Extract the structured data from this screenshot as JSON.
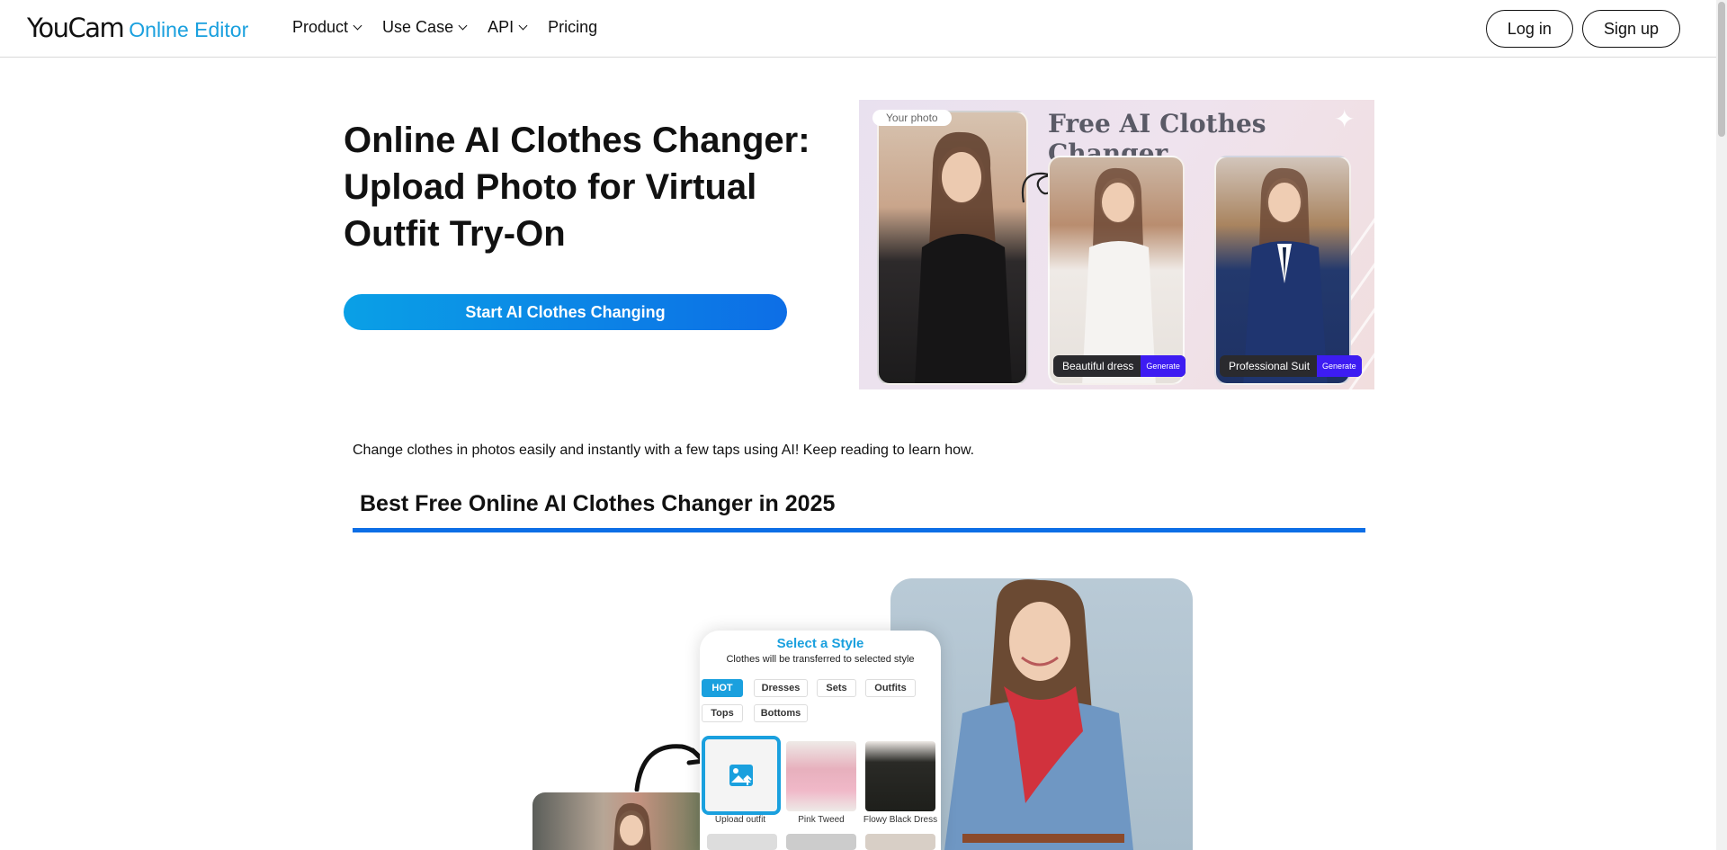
{
  "header": {
    "logo_main": "YouCam",
    "logo_sub": "Online Editor",
    "nav": [
      {
        "label": "Product",
        "has_dropdown": true
      },
      {
        "label": "Use Case",
        "has_dropdown": true
      },
      {
        "label": "API",
        "has_dropdown": true
      },
      {
        "label": "Pricing",
        "has_dropdown": false
      }
    ],
    "login_label": "Log in",
    "signup_label": "Sign up"
  },
  "hero": {
    "title": "Online AI Clothes Changer: Upload Photo for Virtual Outfit Try-On",
    "cta_label": "Start AI Clothes Changing",
    "banner": {
      "title": "Free AI Clothes Changer",
      "photo_tag": "Your photo",
      "results": [
        {
          "label": "Beautiful dress",
          "button": "Generate"
        },
        {
          "label": "Professional Suit",
          "button": "Generate"
        }
      ]
    }
  },
  "content": {
    "intro": "Change clothes in photos easily and instantly with a few taps using AI! Keep reading to learn how.",
    "section_title": "Best Free Online AI Clothes Changer in 2025"
  },
  "mockup": {
    "title": "Select a Style",
    "subtitle": "Clothes will be transferred to selected style",
    "categories": [
      "HOT",
      "Dresses",
      "Sets",
      "Outfits",
      "Tops",
      "Bottoms"
    ],
    "active_category": "HOT",
    "tiles": [
      "Upload outfit",
      "Pink Tweed",
      "Flowy Black Dress"
    ]
  },
  "colors": {
    "brand": "#1aa0de",
    "cta_gradient_start": "#0aa0e6",
    "cta_gradient_end": "#0d6ee6",
    "section_rule": "#0d6ee6",
    "generate_button": "#3d1cf2"
  }
}
